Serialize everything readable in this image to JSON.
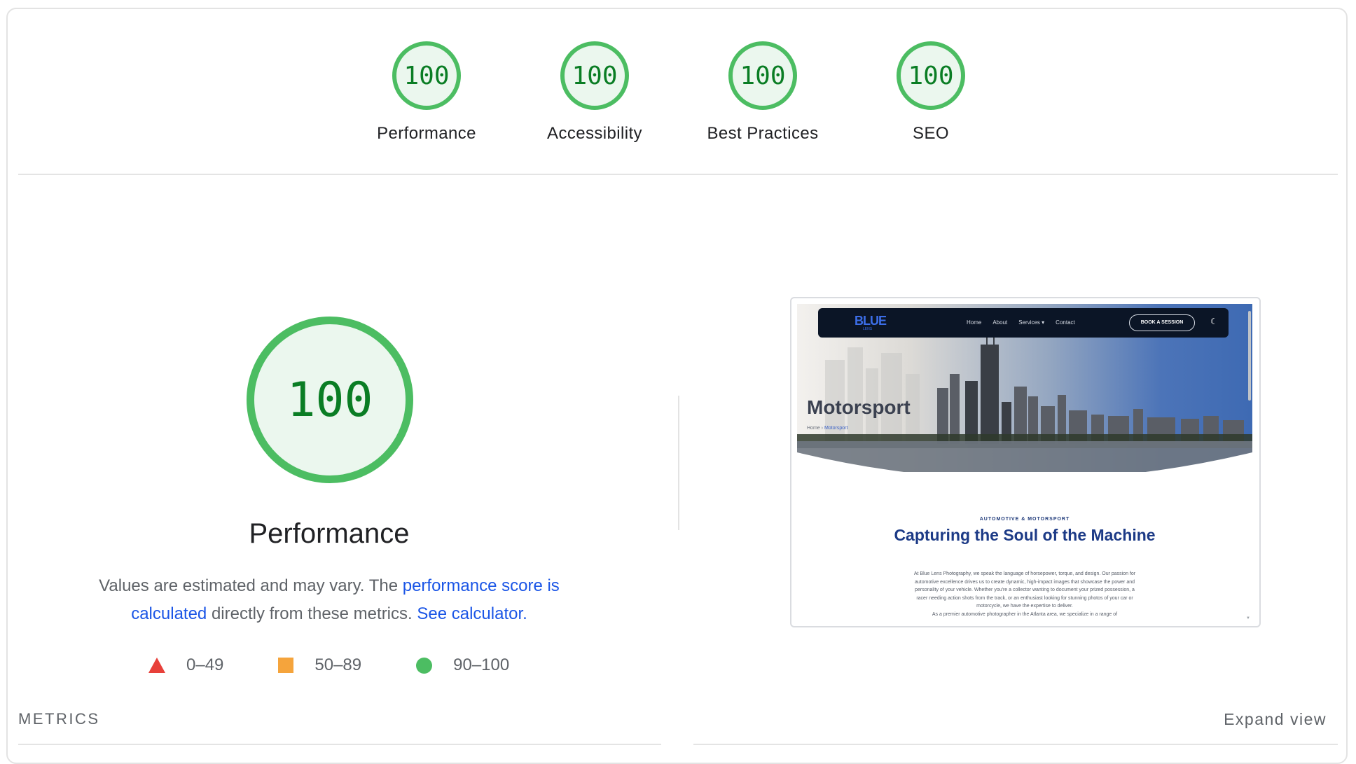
{
  "categories": [
    {
      "score": "100",
      "label": "Performance"
    },
    {
      "score": "100",
      "label": "Accessibility"
    },
    {
      "score": "100",
      "label": "Best Practices"
    },
    {
      "score": "100",
      "label": "SEO"
    }
  ],
  "performance": {
    "score": "100",
    "title": "Performance",
    "desc_prefix": "Values are estimated and may vary. The ",
    "link_score": "performance score is calculated",
    "desc_middle": " directly from these metrics. ",
    "link_calculator": "See calculator."
  },
  "legend": [
    {
      "range": "0–49",
      "shape": "triangle",
      "color": "#e8403a"
    },
    {
      "range": "50–89",
      "shape": "square",
      "color": "#f5a43c"
    },
    {
      "range": "90–100",
      "shape": "circle",
      "color": "#4cbd62"
    }
  ],
  "screenshot": {
    "logo": "BLUE",
    "logo_sub": "LENS",
    "nav_links": [
      "Home",
      "About",
      "Services ▾",
      "Contact"
    ],
    "book_button": "BOOK A SESSION",
    "moon_glyph": "☾",
    "hero_title": "Motorsport",
    "crumb_home": "Home",
    "crumb_sep": "›",
    "crumb_current": "Motorsport",
    "sub_label": "AUTOMOTIVE & MOTORSPORT",
    "heading": "Capturing the Soul of the Machine",
    "body": "At Blue Lens Photography, we speak the language of horsepower, torque, and design. Our passion for automotive excellence drives us to create dynamic, high-impact images that showcase the power and personality of your vehicle. Whether you're a collector wanting to document your prized possession, a racer needing action shots from the track, or an enthusiast looking for stunning photos of your car or motorcycle, we have the expertise to deliver.",
    "body2": "As a premier automotive photographer in the Atlanta area, we specialize in a range of"
  },
  "metrics_label": "METRICS",
  "expand_view": "Expand view",
  "colors": {
    "pass_green": "#4cbd62",
    "pass_text": "#0a7d24",
    "pass_fill": "#ebf7ee",
    "link_blue": "#1a55e6"
  }
}
